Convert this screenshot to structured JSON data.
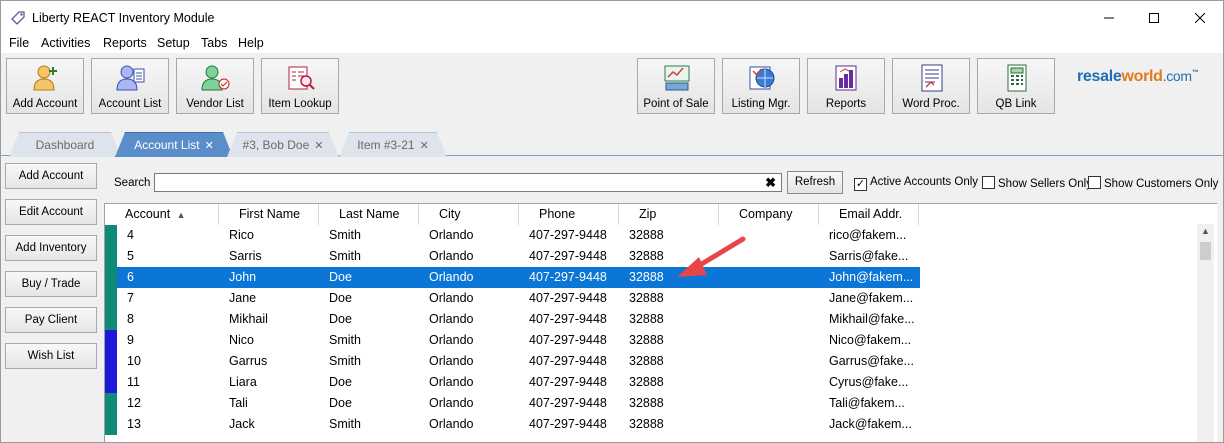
{
  "window": {
    "title": "Liberty REACT Inventory Module"
  },
  "menu": [
    "File",
    "Activities",
    "Reports",
    "Setup",
    "Tabs",
    "Help"
  ],
  "toolbar": {
    "left": [
      {
        "label": "Add Account",
        "icon": "add-account-icon"
      },
      {
        "label": "Account List",
        "icon": "account-list-icon"
      },
      {
        "label": "Vendor List",
        "icon": "vendor-list-icon"
      },
      {
        "label": "Item Lookup",
        "icon": "item-lookup-icon"
      }
    ],
    "right": [
      {
        "label": "Point of Sale",
        "icon": "point-of-sale-icon"
      },
      {
        "label": "Listing Mgr.",
        "icon": "listing-manager-icon"
      },
      {
        "label": "Reports",
        "icon": "reports-icon"
      },
      {
        "label": "Word Proc.",
        "icon": "word-processor-icon"
      },
      {
        "label": "QB Link",
        "icon": "qb-link-icon"
      }
    ],
    "logo": {
      "resale": "resale",
      "world": "world",
      "com": ".com",
      "tm": "™"
    }
  },
  "tabs": [
    {
      "label": "Dashboard",
      "closable": false,
      "active": false
    },
    {
      "label": "Account List",
      "closable": true,
      "active": true
    },
    {
      "label": "#3, Bob Doe",
      "closable": true,
      "active": false
    },
    {
      "label": "Item #3-21",
      "closable": true,
      "active": false
    }
  ],
  "sidebar": [
    "Add Account",
    "Edit Account",
    "Add Inventory",
    "Buy / Trade",
    "Pay Client",
    "Wish List"
  ],
  "search": {
    "label": "Search",
    "value": "",
    "clear": "✖",
    "refresh": "Refresh"
  },
  "filters": [
    {
      "label": "Active Accounts Only",
      "checked": true
    },
    {
      "label": "Show Sellers Only",
      "checked": false
    },
    {
      "label": "Show Customers Only",
      "checked": false
    }
  ],
  "table": {
    "columns": [
      "Account",
      "First Name",
      "Last Name",
      "City",
      "Phone",
      "Zip",
      "Company",
      "Email Addr."
    ],
    "sort_indicator": "▲",
    "rows": [
      {
        "marker": "#108a78",
        "cells": [
          "4",
          "Rico",
          "Smith",
          "Orlando",
          "407-297-9448",
          "32888",
          "",
          "rico@fakem..."
        ]
      },
      {
        "marker": "#108a78",
        "cells": [
          "5",
          "Sarris",
          "Smith",
          "Orlando",
          "407-297-9448",
          "32888",
          "",
          "Sarris@fake..."
        ]
      },
      {
        "marker": "#108a78",
        "cells": [
          "6",
          "John",
          "Doe",
          "Orlando",
          "407-297-9448",
          "32888",
          "",
          "John@fakem..."
        ],
        "selected": true
      },
      {
        "marker": "#108a78",
        "cells": [
          "7",
          "Jane",
          "Doe",
          "Orlando",
          "407-297-9448",
          "32888",
          "",
          "Jane@fakem..."
        ]
      },
      {
        "marker": "#108a78",
        "cells": [
          "8",
          "Mikhail",
          "Doe",
          "Orlando",
          "407-297-9448",
          "32888",
          "",
          "Mikhail@fake..."
        ]
      },
      {
        "marker": "#1a1ad8",
        "cells": [
          "9",
          "Nico",
          "Smith",
          "Orlando",
          "407-297-9448",
          "32888",
          "",
          "Nico@fakem..."
        ]
      },
      {
        "marker": "#1a1ad8",
        "cells": [
          "10",
          "Garrus",
          "Smith",
          "Orlando",
          "407-297-9448",
          "32888",
          "",
          "Garrus@fake..."
        ]
      },
      {
        "marker": "#1a1ad8",
        "cells": [
          "11",
          "Liara",
          "Doe",
          "Orlando",
          "407-297-9448",
          "32888",
          "",
          "Cyrus@fake..."
        ]
      },
      {
        "marker": "#108a78",
        "cells": [
          "12",
          "Tali",
          "Doe",
          "Orlando",
          "407-297-9448",
          "32888",
          "",
          "Tali@fakem..."
        ]
      },
      {
        "marker": "#108a78",
        "cells": [
          "13",
          "Jack",
          "Smith",
          "Orlando",
          "407-297-9448",
          "32888",
          "",
          "Jack@fakem..."
        ]
      }
    ]
  },
  "colors": {
    "selection": "#0c76d7",
    "active_tab": "#5a8ecb",
    "arrow": "#e8454a"
  }
}
